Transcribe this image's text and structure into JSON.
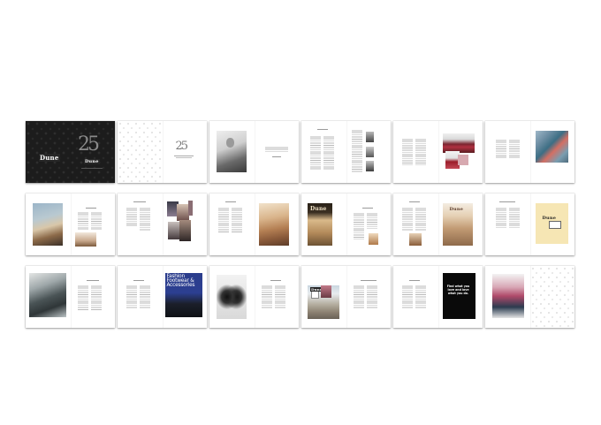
{
  "cover": {
    "logo": "Dune",
    "anniversary": "25",
    "sub_logo": "Dune"
  },
  "title_page": {
    "anniversary": "25"
  },
  "spreads_r2": {
    "storefront_logo": "Dune",
    "interior_logo": "Dune",
    "ad_logo": "Dune"
  },
  "spreads_r3": {
    "magazine_text": "Fashion Footwear & Accessories",
    "billboard_logo": "Dune",
    "quote": "Find what you love and love what you do."
  }
}
